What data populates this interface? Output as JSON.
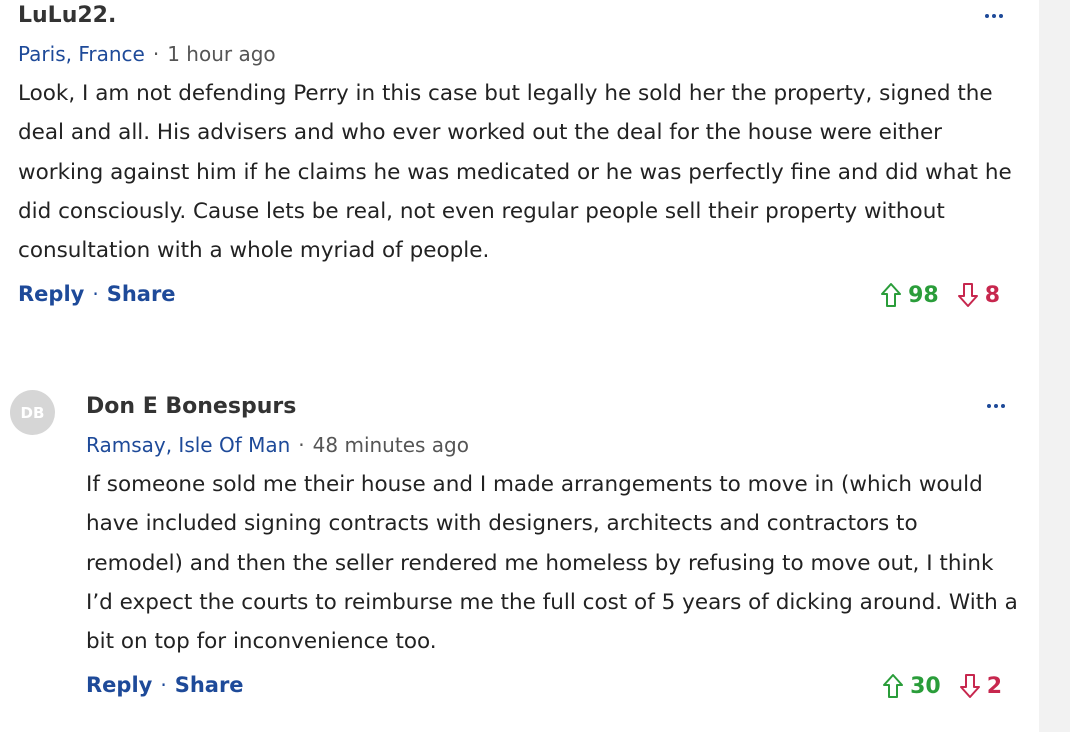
{
  "comments": [
    {
      "author": "LuLu22.",
      "location": "Paris, France",
      "time": "1 hour ago",
      "text": "Look, I am not defending Perry in this case but legally he sold her the property, signed the deal and all. His advisers and who ever worked out the deal for the house were either working against him if he claims he was medicated or he was perfectly fine and did what he did consciously. Cause lets be real, not even regular people sell their property without consultation with a whole myriad of people.",
      "reply_label": "Reply",
      "share_label": "Share",
      "upvotes": "98",
      "downvotes": "8"
    },
    {
      "avatar_initials": "DB",
      "author": "Don E Bonespurs",
      "location": "Ramsay, Isle Of Man",
      "time": "48 minutes ago",
      "text": "If someone sold me their house and I made arrangements to move in (which would have included signing contracts with designers, architects and contractors to remodel) and then the seller rendered me homeless by refusing to move out, I think I’d expect the courts to reimburse me the full cost of 5 years of dicking around.   With a bit on top for inconvenience too.",
      "reply_label": "Reply",
      "share_label": "Share",
      "upvotes": "30",
      "downvotes": "2"
    }
  ],
  "separator": "·",
  "colors": {
    "link": "#1e4a99",
    "upvote": "#2a9d3a",
    "downvote": "#c7274e",
    "avatar_bg": "#d6d6d6",
    "gutter": "#f2f2f2"
  },
  "icons": [
    "more-options-icon",
    "upvote-arrow-icon",
    "downvote-arrow-icon"
  ]
}
